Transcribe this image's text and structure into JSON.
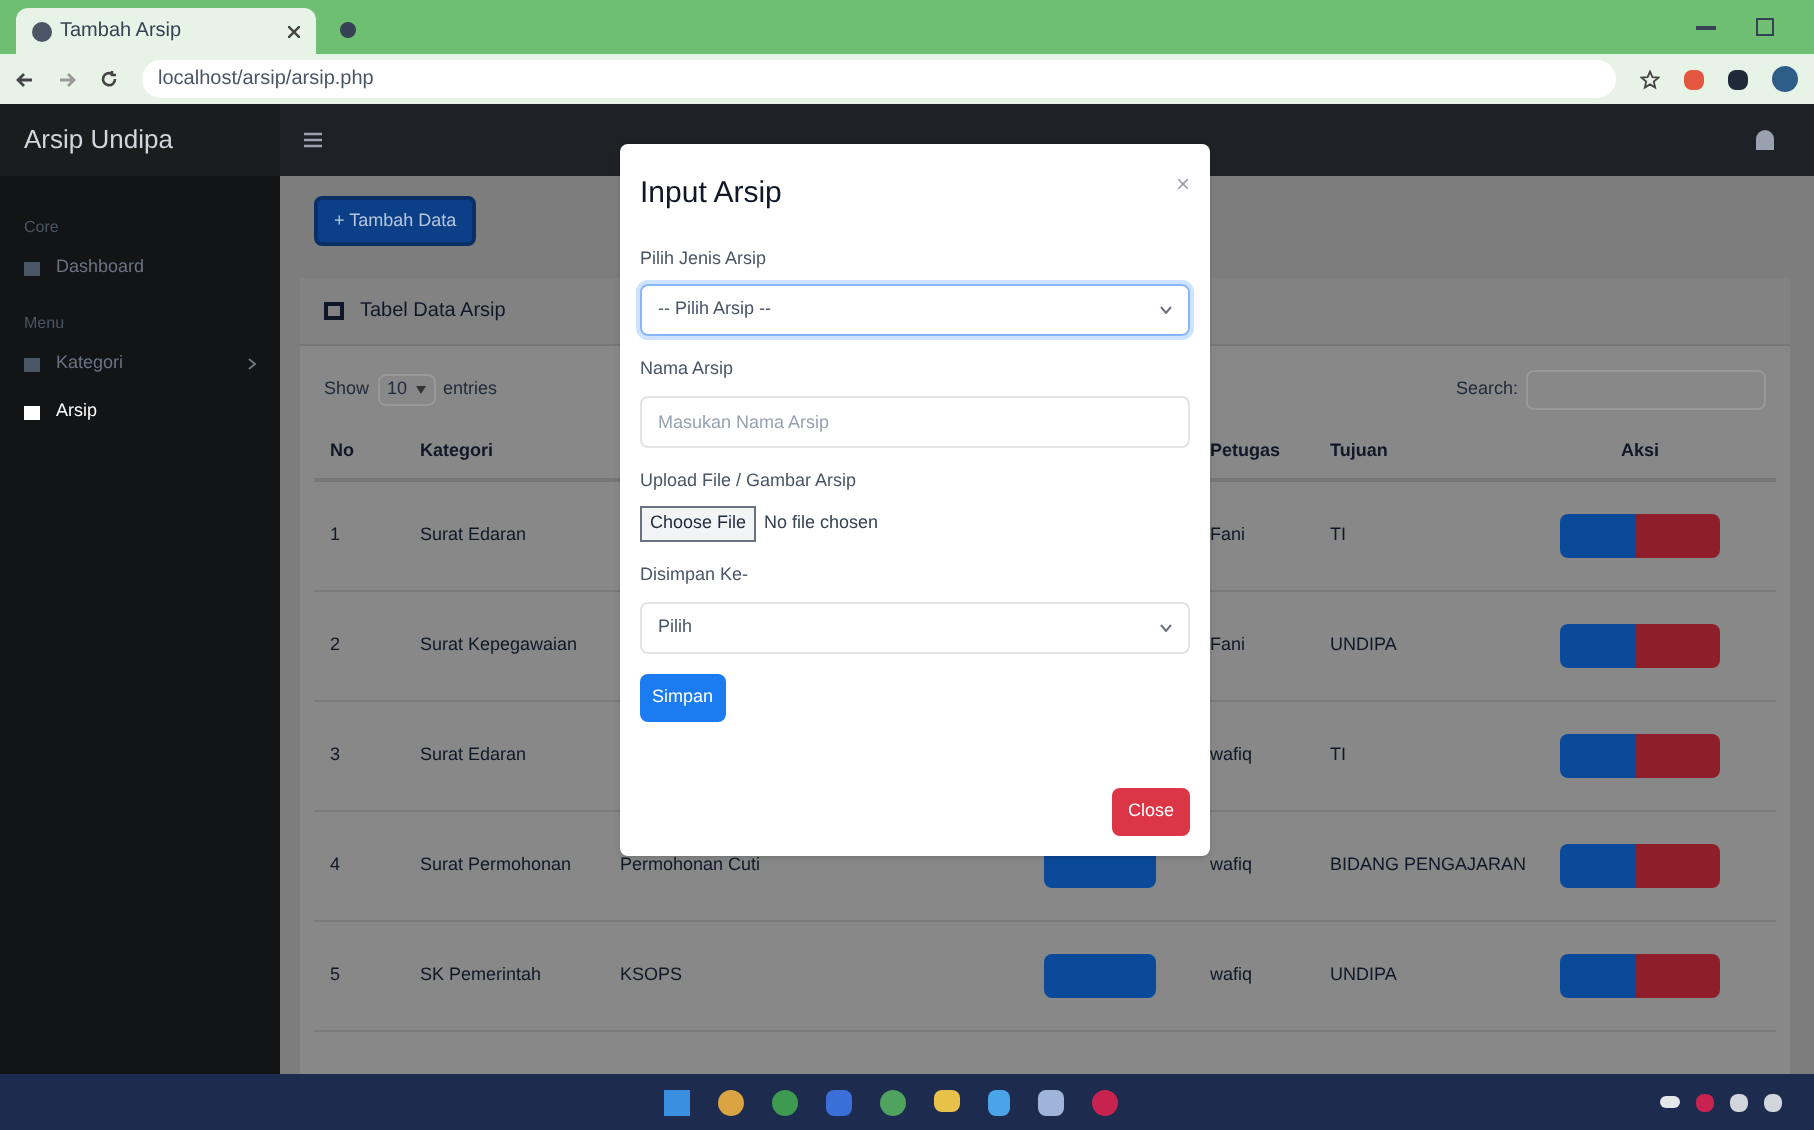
{
  "browser": {
    "tab_title": "Tambah Arsip",
    "url": "localhost/arsip/arsip.php"
  },
  "navbar": {
    "brand": "Arsip Undipa"
  },
  "sidebar": {
    "items": [
      {
        "kind": "heading",
        "label": "Core"
      },
      {
        "kind": "link",
        "label": "Dashboard",
        "selected": false,
        "expandable": false
      },
      {
        "kind": "heading",
        "label": "Menu"
      },
      {
        "kind": "link",
        "label": "Kategori",
        "selected": false,
        "expandable": true
      },
      {
        "kind": "link",
        "label": "Arsip",
        "selected": true,
        "expandable": false
      }
    ]
  },
  "add_button": "+ Tambah Data",
  "card": {
    "title": "Tabel Data Arsip",
    "show_before": "Show",
    "entries_value": "10",
    "show_after": "entries",
    "search_label": "Search:"
  },
  "table": {
    "columns": [
      "No",
      "Kategori",
      "Petugas",
      "Tujuan",
      "Aksi"
    ],
    "rows": [
      {
        "no": "1",
        "kategori": "Surat Edaran",
        "petugas": "Fani",
        "tujuan": "TI"
      },
      {
        "no": "2",
        "kategori": "Surat Kepegawaian",
        "petugas": "Fani",
        "tujuan": "UNDIPA"
      },
      {
        "no": "3",
        "kategori": "Surat Edaran",
        "petugas": "wafiq",
        "tujuan": "TI"
      },
      {
        "no": "4",
        "kategori": "Surat Permohonan",
        "nama_arsip": "Permohonan Cuti",
        "petugas": "wafiq",
        "tujuan": "BIDANG PENGAJARAN"
      },
      {
        "no": "5",
        "kategori": "SK Pemerintah",
        "nama_arsip": "KSOPS",
        "petugas": "wafiq",
        "tujuan": "UNDIPA"
      }
    ]
  },
  "modal": {
    "title": "Input Arsip",
    "close_icon": "×",
    "fields": [
      {
        "kind": "select",
        "label": "Pilih Jenis Arsip",
        "value": "-- Pilih Arsip --",
        "focused": true
      },
      {
        "kind": "text",
        "label": "Nama Arsip",
        "placeholder": "Masukan Nama Arsip"
      },
      {
        "kind": "file",
        "label": "Upload File / Gambar Arsip",
        "button": "Choose File",
        "status": "No file chosen"
      },
      {
        "kind": "select",
        "label": "Disimpan Ke-",
        "value": "Pilih",
        "focused": false
      }
    ],
    "submit": "Simpan",
    "close": "Close"
  }
}
